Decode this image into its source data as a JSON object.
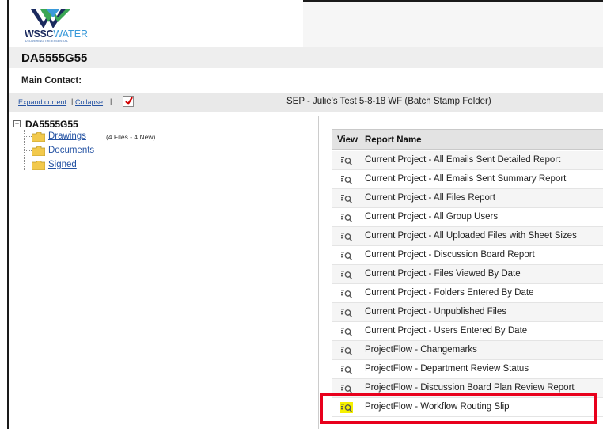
{
  "logo": {
    "brand_a": "WSSC",
    "brand_b": "WATER",
    "tagline": "DELIVERING THE ESSENTIAL"
  },
  "project": {
    "title": "DA5555G55"
  },
  "contact": {
    "label": "Main Contact:"
  },
  "toolbar": {
    "expand_label": "Expand current",
    "separator": "|",
    "collapse_label": "Collapse",
    "folder_caption": "SEP - Julie's Test 5-8-18 WF (Batch Stamp Folder)"
  },
  "tree": {
    "root_toggle": "−",
    "root_label": "DA5555G55",
    "items": [
      {
        "label": "Drawings",
        "count": "(4 Files - 4 New)"
      },
      {
        "label": "Documents",
        "count": ""
      },
      {
        "label": "Signed",
        "count": ""
      }
    ]
  },
  "reports": {
    "header_view": "View",
    "header_name": "Report Name",
    "rows": [
      {
        "name": "Current Project - All Emails Sent Detailed Report"
      },
      {
        "name": "Current Project - All Emails Sent Summary Report"
      },
      {
        "name": "Current Project - All Files Report"
      },
      {
        "name": "Current Project - All Group Users"
      },
      {
        "name": "Current Project - All Uploaded Files with Sheet Sizes"
      },
      {
        "name": "Current Project - Discussion Board Report"
      },
      {
        "name": "Current Project - Files Viewed By Date"
      },
      {
        "name": "Current Project - Folders Entered By Date"
      },
      {
        "name": "Current Project - Unpublished Files"
      },
      {
        "name": "Current Project - Users Entered By Date"
      },
      {
        "name": "ProjectFlow - Changemarks"
      },
      {
        "name": "ProjectFlow - Department Review Status"
      },
      {
        "name": "ProjectFlow - Discussion Board Plan Review Report"
      },
      {
        "name": "ProjectFlow - Workflow Routing Slip"
      }
    ],
    "highlighted_row": "ProjectFlow - Workflow Routing Slip"
  },
  "icons": {
    "report_view": "report-view-icon",
    "folder": "folder-icon",
    "checkmark": "red-checkmark-icon"
  },
  "colors": {
    "link": "#2553a3",
    "highlight_border": "#e8001c",
    "highlight_icon": "#f5f000",
    "folder": "#f2c94c"
  }
}
